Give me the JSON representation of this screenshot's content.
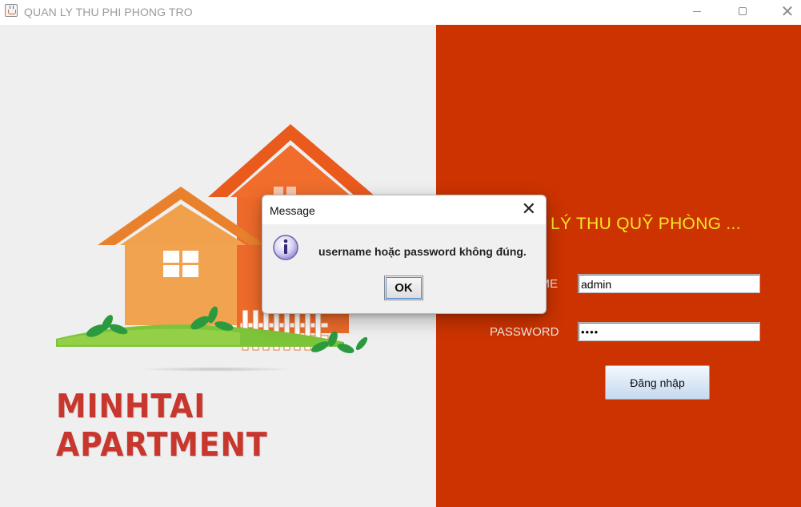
{
  "window": {
    "title": "QUAN LY THU PHI PHONG TRO",
    "icon": "java-cup-icon",
    "controls": [
      "minimize-icon",
      "maximize-icon",
      "close-icon"
    ],
    "close_glyph": "✕"
  },
  "left_panel": {
    "brand_text": "MINHTAI APARTMENT",
    "colors": {
      "background": "#efefef",
      "brand": "#c8372d"
    }
  },
  "login_form": {
    "title": "QUẢN LÝ THU QUỸ PHÒNG ...",
    "username_label": "USERNAME",
    "username_value": "admin",
    "password_label": "PASSWORD",
    "password_value": "••••",
    "login_button": "Đăng nhập",
    "colors": {
      "background": "#cc3300",
      "title": "#f7e625"
    }
  },
  "dialog": {
    "title": "Message",
    "message": "username hoặc password không đúng.",
    "ok_button": "OK",
    "close_glyph": "✕",
    "icon": "info-icon"
  }
}
